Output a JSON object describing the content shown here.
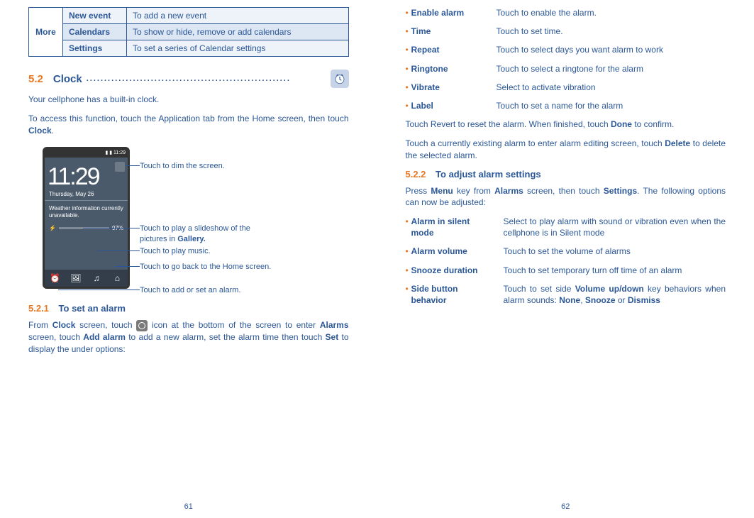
{
  "left": {
    "cal_table": {
      "more": "More",
      "rows": [
        {
          "label": "New event",
          "desc": "To add a new event"
        },
        {
          "label": "Calendars",
          "desc": "To show or hide, remove or add calendars"
        },
        {
          "label": "Settings",
          "desc": "To set a series of Calendar settings"
        }
      ]
    },
    "sec_num": "5.2",
    "sec_title": "Clock",
    "p1": "Your cellphone has a built-in clock.",
    "p2a": "To access this function, touch the Application tab from the Home screen, then touch ",
    "p2b": "Clock",
    "p2c": ".",
    "phone": {
      "status_time": "11:29",
      "big_time": "11:29",
      "date": "Thursday, May 26",
      "weather1": "Weather information currently",
      "weather2": "unavailable.",
      "battery": "97%"
    },
    "callouts": {
      "dim": "Touch to dim the screen.",
      "slideshow1": "Touch to play a slideshow of the",
      "slideshow2a": "pictures in ",
      "slideshow2b": "Gallery.",
      "music": "Touch to play music.",
      "home": "Touch to go back to the Home screen.",
      "alarm": "Touch to add or set an alarm."
    },
    "sub_num": "5.2.1",
    "sub_title": "To set an alarm",
    "p3a": "From ",
    "p3b": "Clock",
    "p3c": " screen, touch ",
    "p3d": " icon at the bottom of the screen to enter ",
    "p3e": "Alarms",
    "p3f": " screen, touch ",
    "p3g": "Add alarm",
    "p3h": " to add a new alarm, set the alarm time then touch ",
    "p3i": "Set",
    "p3j": " to display the under options:",
    "page_num": "61"
  },
  "right": {
    "opts1": [
      {
        "k": "Enable alarm",
        "v": "Touch to enable the alarm."
      },
      {
        "k": "Time",
        "v": "Touch to set time."
      },
      {
        "k": "Repeat",
        "v": "Touch to select days you want alarm to work"
      },
      {
        "k": "Ringtone",
        "v": "Touch to select a ringtone for the alarm"
      },
      {
        "k": "Vibrate",
        "v": "Select to activate vibration"
      },
      {
        "k": "Label",
        "v": "Touch to set a name for the alarm"
      }
    ],
    "p1a": "Touch Revert to reset the alarm. When finished, touch ",
    "p1b": "Done",
    "p1c": " to confirm.",
    "p2a": "Touch a currently existing alarm to enter alarm editing screen, touch ",
    "p2b": "Delete",
    "p2c": " to delete the selected alarm.",
    "sub_num": "5.2.2",
    "sub_title": "To adjust alarm settings",
    "p3a": "Press ",
    "p3b": "Menu",
    "p3c": " key from ",
    "p3d": "Alarms",
    "p3e": " screen, then touch ",
    "p3f": "Settings",
    "p3g": ". The following options can now be adjusted:",
    "opts2": {
      "r1k1": "Alarm in silent",
      "r1k2": "mode",
      "r1v": "Select to play alarm with sound or vibration even when the cellphone is in Silent mode",
      "r2k": "Alarm volume",
      "r2v": "Touch to set the volume of alarms",
      "r3k": "Snooze duration",
      "r3v": "Touch to set temporary turn off time of an alarm",
      "r4k1": "Side button",
      "r4k2": "behavior",
      "r4va": "Touch to set side ",
      "r4vb": "Volume up/down",
      "r4vc": " key behaviors when alarm sounds: ",
      "r4vd": "None",
      "r4ve": ", ",
      "r4vf": "Snooze",
      "r4vg": " or ",
      "r4vh": "Dismiss"
    },
    "page_num": "62"
  }
}
